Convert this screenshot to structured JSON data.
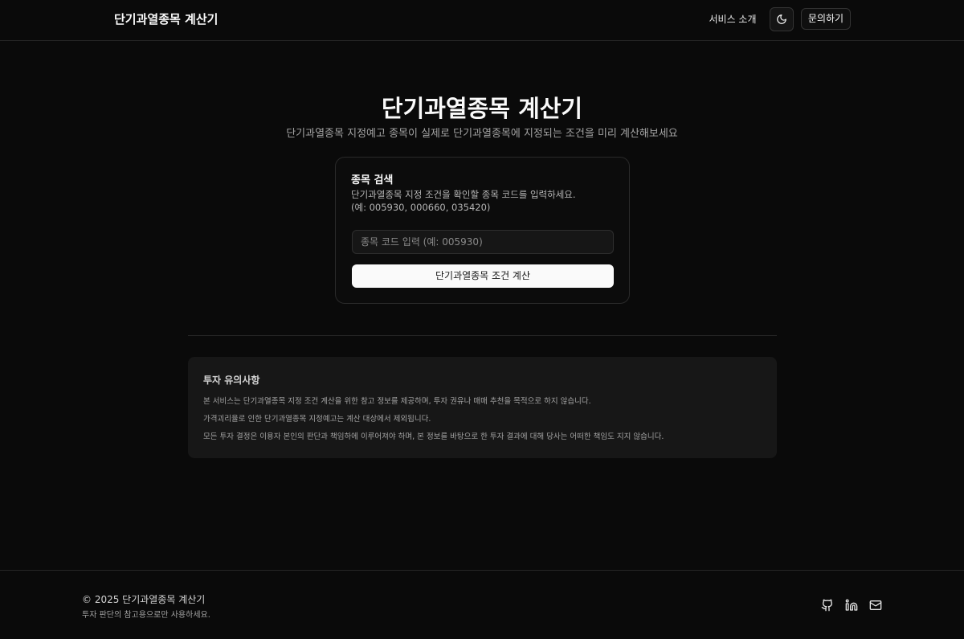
{
  "header": {
    "brand": "단기과열종목 계산기",
    "nav_about": "서비스 소개",
    "theme_icon": "moon-icon",
    "contact": "문의하기"
  },
  "hero": {
    "title": "단기과열종목 계산기",
    "subtitle": "단기과열종목 지정예고 종목이 실제로 단기과열종목에 지정되는 조건을 미리 계산해보세요"
  },
  "search_card": {
    "title": "종목 검색",
    "description_line1": "단기과열종목 지정 조건을 확인할 종목 코드를 입력하세요.",
    "description_line2": "(예: 005930, 000660, 035420)",
    "input_placeholder": "종목 코드 입력 (예: 005930)",
    "input_value": "",
    "button_label": "단기과열종목 조건 계산"
  },
  "notice": {
    "title": "투자 유의사항",
    "lines": [
      "본 서비스는 단기과열종목 지정 조건 계산을 위한 참고 정보를 제공하며, 투자 권유나 매매 추천을 목적으로 하지 않습니다.",
      "가격괴리율로 인한 단기과열종목 지정예고는 계산 대상에서 제외됩니다.",
      "모든 투자 결정은 이용자 본인의 판단과 책임하에 이루어져야 하며, 본 정보를 바탕으로 한 투자 결과에 대해 당사는 어떠한 책임도 지지 않습니다."
    ]
  },
  "footer": {
    "copyright": "© 2025 단기과열종목 계산기",
    "note": "투자 판단의 참고용으로만 사용하세요.",
    "social_icons": [
      "github-icon",
      "linkedin-icon",
      "mail-icon"
    ]
  },
  "colors": {
    "background": "#0a0a0a",
    "primary_button": "#fafafa",
    "notice_background": "#171717"
  }
}
